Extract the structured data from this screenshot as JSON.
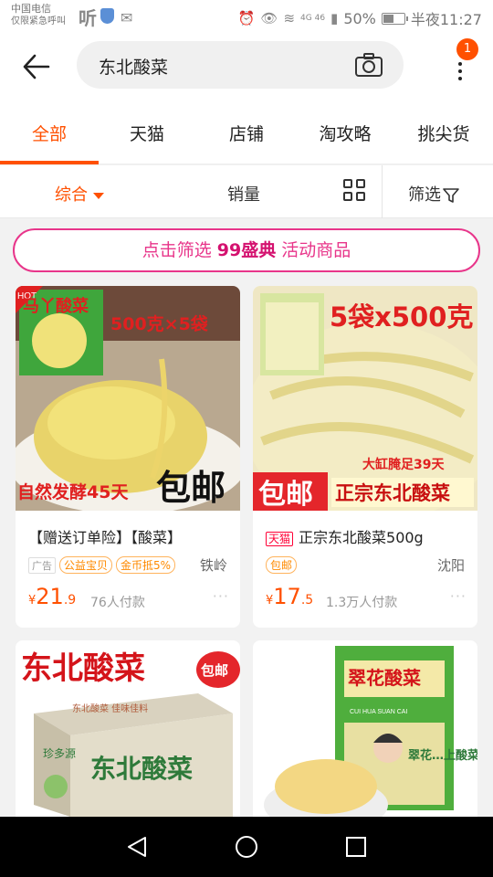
{
  "status_bar": {
    "carrier_line1": "中国电信",
    "carrier_line2": "仅限紧急呼叫",
    "ting_glyph": "听",
    "network": "4G 46",
    "battery_percent": "50%",
    "battery_level": 0.5,
    "time": "半夜11:27"
  },
  "header": {
    "search_value": "东北酸菜",
    "notification_count": "1"
  },
  "tabs": [
    {
      "label": "全部",
      "active": true
    },
    {
      "label": "天猫"
    },
    {
      "label": "店铺"
    },
    {
      "label": "淘攻略"
    },
    {
      "label": "挑尖货"
    }
  ],
  "sort": {
    "comprehensive": "综合",
    "sales": "销量",
    "filter": "筛选"
  },
  "promo": {
    "prefix": "点击筛选",
    "highlight": "99盛典",
    "suffix": "活动商品"
  },
  "products": [
    {
      "image_texts": {
        "badge": "HOT",
        "brand": "马丫酸菜",
        "spec": "500克×5袋",
        "ferment": "自然发酵45天",
        "free_ship": "包邮"
      },
      "title": "【赠送订单险】【酸菜】",
      "tags": [
        "广告",
        "公益宝贝",
        "金币抵5%"
      ],
      "location": "铁岭",
      "price_symbol": "¥",
      "price_int": "21",
      "price_dec": ".9",
      "paid": "76人付款",
      "more": "···"
    },
    {
      "image_texts": {
        "spec": "5袋x500克",
        "jar": "大缸腌足39天",
        "free_ship": "包邮",
        "name": "正宗东北酸菜"
      },
      "tmall": "天猫",
      "title": "正宗东北酸菜500g",
      "tags": [
        "包邮"
      ],
      "location": "沈阳",
      "price_symbol": "¥",
      "price_int": "17",
      "price_dec": ".5",
      "paid": "1.3万人付款",
      "more": "···"
    },
    {
      "image_texts": {
        "headline": "东北酸菜",
        "free_ship": "包邮",
        "box_brand": "珍多源",
        "box_name": "东北酸菜",
        "box_top": "东北酸菜  佳味佳料"
      }
    },
    {
      "image_texts": {
        "brand": "翠花酸菜",
        "pinyin": "CUI HUA SUAN CAI",
        "side": "翠花…上酸菜"
      }
    }
  ],
  "colors": {
    "accent": "#ff5000",
    "promo": "#e8358a",
    "tmall": "#ff0036"
  }
}
